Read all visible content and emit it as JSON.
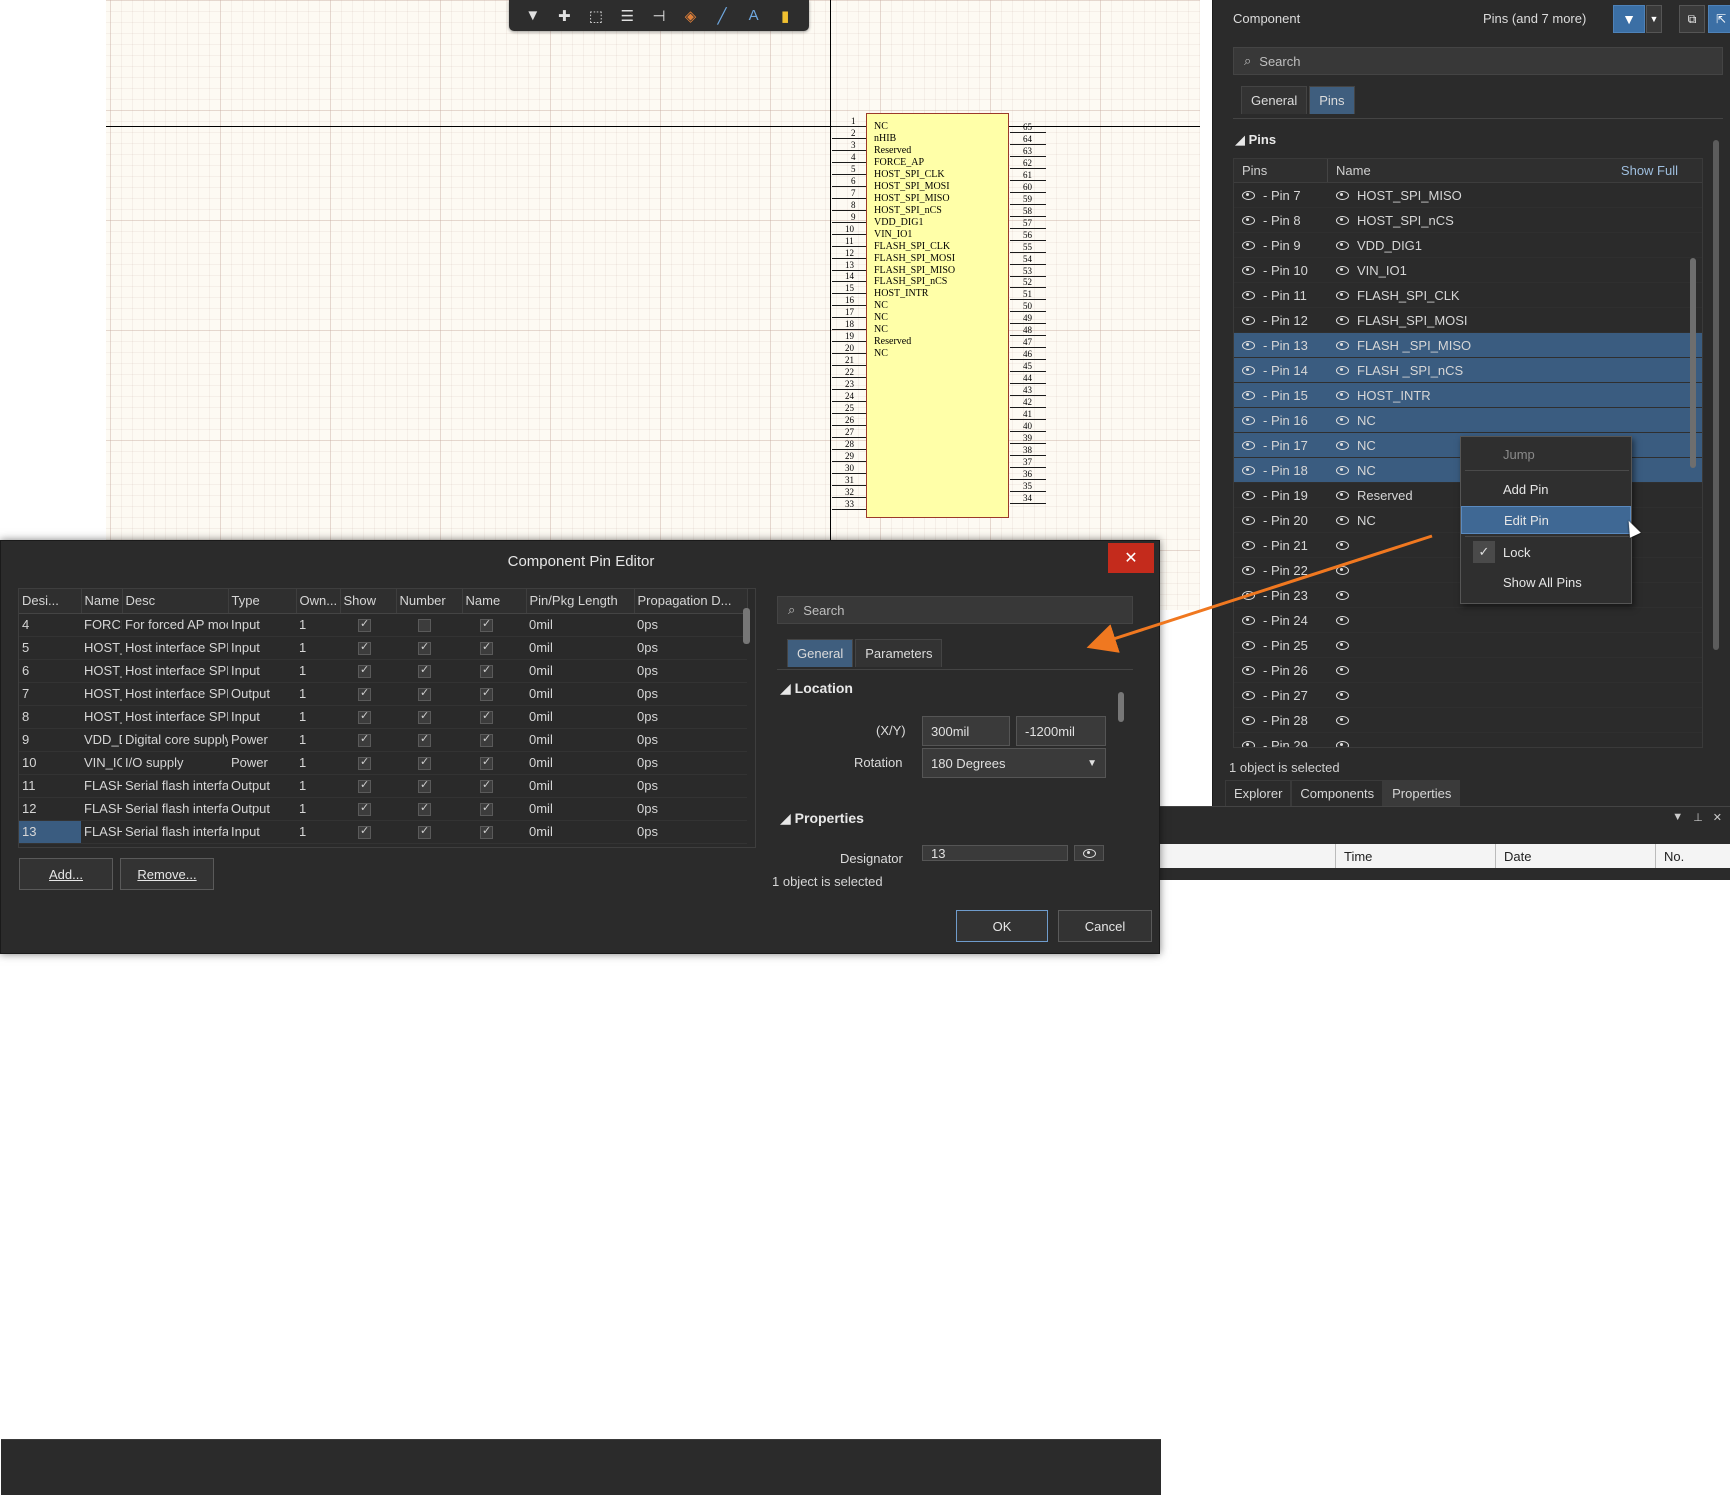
{
  "toolbar": {
    "icons": [
      "filter-icon",
      "cross-icon",
      "select-box-icon",
      "align-icon",
      "pin-icon",
      "fill-icon",
      "line-icon",
      "text-icon",
      "note-icon"
    ],
    "text_glyph": "A"
  },
  "schematic": {
    "left_pin_names": [
      "NC",
      "nHIB",
      "Reserved",
      "FORCE_AP",
      "HOST_SPI_CLK",
      "HOST_SPI_MOSI",
      "HOST_SPI_MISO",
      "HOST_SPI_nCS",
      "VDD_DIG1",
      "VIN_IO1",
      "FLASH_SPI_CLK",
      "FLASH_SPI_MOSI",
      "FLASH_SPI_MISO",
      "FLASH_SPI_nCS",
      "HOST_INTR",
      "NC",
      "NC",
      "NC",
      "Reserved",
      "NC"
    ],
    "left_pin_numbers": [
      "1",
      "2",
      "3",
      "4",
      "5",
      "6",
      "7",
      "8",
      "9",
      "10",
      "11",
      "12",
      "13",
      "14",
      "15",
      "16",
      "17",
      "18",
      "19",
      "20",
      "21",
      "22",
      "23",
      "24",
      "25",
      "26",
      "27",
      "28",
      "29",
      "30",
      "31",
      "32",
      "33"
    ],
    "right_pin_numbers": [
      "65",
      "64",
      "63",
      "62",
      "61",
      "60",
      "59",
      "58",
      "57",
      "56",
      "55",
      "54",
      "53",
      "52",
      "51",
      "50",
      "49",
      "48",
      "47",
      "46",
      "45",
      "44",
      "43",
      "42",
      "41",
      "40",
      "39",
      "38",
      "37",
      "36",
      "35",
      "34"
    ]
  },
  "panel": {
    "title": "Component",
    "filter_label": "Pins (and 7 more)",
    "search_placeholder": "Search",
    "tabs": [
      "General",
      "Pins"
    ],
    "section_title": "Pins",
    "grid_headers": {
      "pins": "Pins",
      "name": "Name",
      "show_full": "Show Full"
    },
    "rows": [
      {
        "pin": "- Pin 7",
        "name": "HOST_SPI_MISO",
        "selected": false
      },
      {
        "pin": "- Pin 8",
        "name": "HOST_SPI_nCS",
        "selected": false
      },
      {
        "pin": "- Pin 9",
        "name": "VDD_DIG1",
        "selected": false
      },
      {
        "pin": "- Pin 10",
        "name": "VIN_IO1",
        "selected": false
      },
      {
        "pin": "- Pin 11",
        "name": "FLASH_SPI_CLK",
        "selected": false
      },
      {
        "pin": "- Pin 12",
        "name": "FLASH_SPI_MOSI",
        "selected": false
      },
      {
        "pin": "- Pin 13",
        "name": "FLASH _SPI_MISO",
        "selected": true
      },
      {
        "pin": "- Pin 14",
        "name": "FLASH _SPI_nCS",
        "selected": true
      },
      {
        "pin": "- Pin 15",
        "name": "HOST_INTR",
        "selected": true
      },
      {
        "pin": "- Pin 16",
        "name": "NC",
        "selected": true
      },
      {
        "pin": "- Pin 17",
        "name": "NC",
        "selected": true
      },
      {
        "pin": "- Pin 18",
        "name": "NC",
        "selected": true
      },
      {
        "pin": "- Pin 19",
        "name": "Reserved",
        "selected": false
      },
      {
        "pin": "- Pin 20",
        "name": "NC",
        "selected": false
      },
      {
        "pin": "- Pin 21",
        "name": "",
        "selected": false
      },
      {
        "pin": "- Pin 22",
        "name": "",
        "selected": false
      },
      {
        "pin": "- Pin 23",
        "name": "",
        "selected": false
      },
      {
        "pin": "- Pin 24",
        "name": "",
        "selected": false
      },
      {
        "pin": "- Pin 25",
        "name": "",
        "selected": false
      },
      {
        "pin": "- Pin 26",
        "name": "",
        "selected": false
      },
      {
        "pin": "- Pin 27",
        "name": "",
        "selected": false
      },
      {
        "pin": "- Pin 28",
        "name": "",
        "selected": false
      },
      {
        "pin": "- Pin 29",
        "name": "",
        "selected": false
      }
    ],
    "status": "1 object is selected",
    "bottom_tabs": [
      "Explorer",
      "Components",
      "Properties"
    ]
  },
  "context_menu": {
    "items": [
      "Jump",
      "Add Pin",
      "Edit Pin",
      "Lock",
      "Show All Pins"
    ]
  },
  "messages": {
    "columns": [
      "Time",
      "Date",
      "No."
    ]
  },
  "dialog": {
    "title": "Component Pin Editor",
    "close_glyph": "✕",
    "columns": [
      "Desi...",
      "Name",
      "Desc",
      "Type",
      "Own...",
      "Show",
      "Number",
      "Name",
      "Pin/Pkg Length",
      "Propagation D..."
    ],
    "rows": [
      {
        "des": "4",
        "name": "FORCE",
        "desc": "For forced AP mode",
        "type": "Input",
        "own": "1",
        "show": true,
        "number": false,
        "pname": true,
        "len": "0mil",
        "prop": "0ps"
      },
      {
        "des": "5",
        "name": "HOST_",
        "desc": "Host interface SPI",
        "type": "Input",
        "own": "1",
        "show": true,
        "number": true,
        "pname": true,
        "len": "0mil",
        "prop": "0ps"
      },
      {
        "des": "6",
        "name": "HOST_",
        "desc": "Host interface SPI",
        "type": "Input",
        "own": "1",
        "show": true,
        "number": true,
        "pname": true,
        "len": "0mil",
        "prop": "0ps"
      },
      {
        "des": "7",
        "name": "HOST_",
        "desc": "Host interface SPI",
        "type": "Output",
        "own": "1",
        "show": true,
        "number": true,
        "pname": true,
        "len": "0mil",
        "prop": "0ps"
      },
      {
        "des": "8",
        "name": "HOST_",
        "desc": "Host interface SPI",
        "type": "Input",
        "own": "1",
        "show": true,
        "number": true,
        "pname": true,
        "len": "0mil",
        "prop": "0ps"
      },
      {
        "des": "9",
        "name": "VDD_D",
        "desc": "Digital core supply",
        "type": "Power",
        "own": "1",
        "show": true,
        "number": true,
        "pname": true,
        "len": "0mil",
        "prop": "0ps"
      },
      {
        "des": "10",
        "name": "VIN_IO",
        "desc": "I/O supply",
        "type": "Power",
        "own": "1",
        "show": true,
        "number": true,
        "pname": true,
        "len": "0mil",
        "prop": "0ps"
      },
      {
        "des": "11",
        "name": "FLASH",
        "desc": "Serial flash interface",
        "type": "Output",
        "own": "1",
        "show": true,
        "number": true,
        "pname": true,
        "len": "0mil",
        "prop": "0ps"
      },
      {
        "des": "12",
        "name": "FLASH",
        "desc": "Serial flash interface",
        "type": "Output",
        "own": "1",
        "show": true,
        "number": true,
        "pname": true,
        "len": "0mil",
        "prop": "0ps"
      },
      {
        "des": "13",
        "name": "FLASH",
        "desc": "Serial flash interface",
        "type": "Input",
        "own": "1",
        "show": true,
        "number": true,
        "pname": true,
        "len": "0mil",
        "prop": "0ps"
      }
    ],
    "add_label": "Add...",
    "remove_label": "Remove...",
    "search_placeholder": "Search",
    "tabs": [
      "General",
      "Parameters"
    ],
    "location_title": "Location",
    "xy_label": "(X/Y)",
    "x_value": "300mil",
    "y_value": "-1200mil",
    "rotation_label": "Rotation",
    "rotation_value": "180 Degrees",
    "properties_title": "Properties",
    "designator_label": "Designator",
    "designator_value": "13",
    "status": "1 object is selected",
    "ok_label": "OK",
    "cancel_label": "Cancel"
  },
  "colors": {
    "accent": "#3b6fa5",
    "selected_row": "#3a5c80",
    "close_red": "#c42b1c",
    "arrow": "#f07820",
    "chip_fill": "#ffffa8"
  }
}
